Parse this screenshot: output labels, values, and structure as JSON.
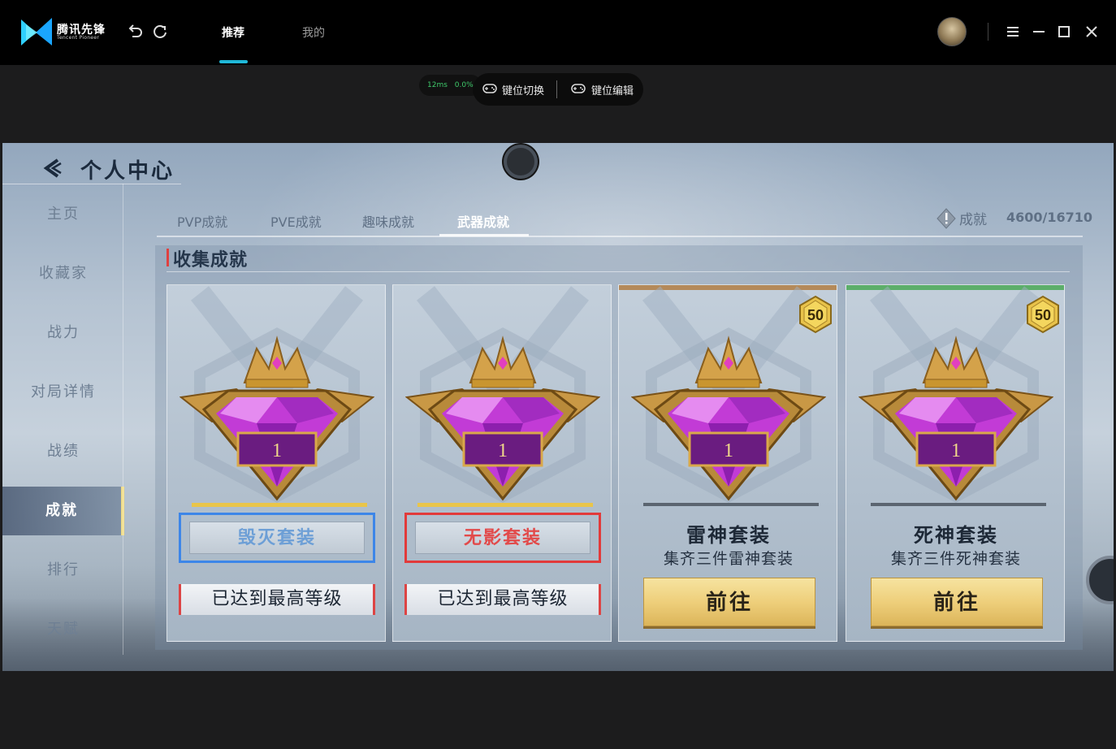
{
  "app": {
    "logo_text": "腾讯先锋",
    "logo_sub": "Tencent Pioneer",
    "nav_tabs": [
      {
        "label": "推荐",
        "active": true
      },
      {
        "label": "我的",
        "active": false
      }
    ],
    "accent_color": "#1fb8d8"
  },
  "toolbar": {
    "ping": "12ms",
    "loss": "0.0%",
    "key_switch": "键位切换",
    "key_edit": "键位编辑"
  },
  "game": {
    "header_title": "个人中心",
    "side_menu": [
      {
        "label": "主页",
        "active": false
      },
      {
        "label": "收藏家",
        "active": false
      },
      {
        "label": "战力",
        "active": false
      },
      {
        "label": "对局详情",
        "active": false
      },
      {
        "label": "战绩",
        "active": false
      },
      {
        "label": "成就",
        "active": true
      },
      {
        "label": "排行",
        "active": false
      },
      {
        "label": "天赋",
        "active": false
      }
    ],
    "tabs": [
      {
        "label": "PVP成就",
        "active": false
      },
      {
        "label": "PVE成就",
        "active": false
      },
      {
        "label": "趣味成就",
        "active": false
      },
      {
        "label": "武器成就",
        "active": true
      }
    ],
    "achievement_label": "成就",
    "achievement_count": "4600/16710",
    "section_title": "收集成就",
    "cards": [
      {
        "medal_level": "1",
        "name": "毁灭套装",
        "status": "已达到最高等级",
        "frame_color": "blue"
      },
      {
        "medal_level": "1",
        "name": "无影套装",
        "status": "已达到最高等级",
        "frame_color": "red"
      },
      {
        "medal_level": "1",
        "badge": "50",
        "name": "雷神套装",
        "desc": "集齐三件雷神套装",
        "action": "前往",
        "top_color": "#b48a5a"
      },
      {
        "medal_level": "1",
        "badge": "50",
        "name": "死神套装",
        "desc": "集齐三件死神套装",
        "action": "前往",
        "top_color": "#5cae6a"
      }
    ]
  }
}
